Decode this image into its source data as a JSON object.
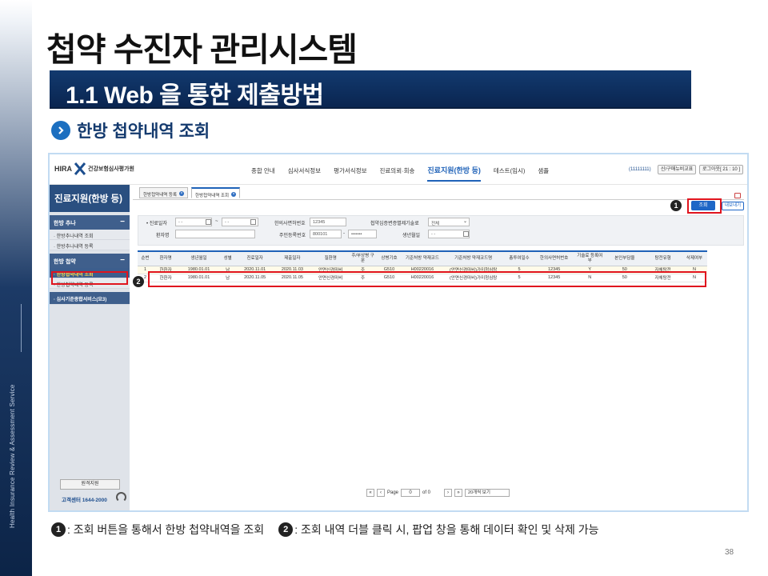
{
  "slide": {
    "title": "첩약 수진자 관리시스템",
    "section": "1.1 Web 을 통한 제출방법",
    "subtitle": "한방 첩약내역 조회",
    "side_vertical_text": "Health Insurance Review & Assessment Service",
    "page_number": "38",
    "note1_marker": "1",
    "note1_text": ": 조회 버튼을 통해서 한방 첩약내역을 조회",
    "note2_marker": "2",
    "note2_text": ": 조회 내역 더블 클릭 시, 팝업 창을 통해 데이터 확인 및 삭제 가능"
  },
  "app": {
    "logo_text": "HIRA",
    "org_name": "건강보험심사평가원",
    "nav": [
      "종합 안내",
      "심사서식정보",
      "평가서식정보",
      "진료의뢰·회송",
      "진료지원(한방 등)",
      "테스트(임시)",
      "샘플"
    ],
    "user_id": "(11111111)",
    "btn_change": "신/구매뉴비교표",
    "btn_logout": "로그아웃[ 21 : 10 ]",
    "sidebar": {
      "title": "진료지원(한방 등)",
      "group1": "한방 추나",
      "group1_items": [
        "· 한방추나내역 조회",
        "· 한방추나내역 등록"
      ],
      "group2": "한방 첩약",
      "group2_items": [
        "· 한방첩약내역 조회",
        "· 한방첩약내역 등록"
      ],
      "other": "· 심사기준종합서비스(요3)",
      "help_btn": "원격지원",
      "phone": "고객센터 1644-2000"
    },
    "tabs": [
      "한방첩약내역 등록",
      "한방첩약내역 조회"
    ],
    "search_btn": "조회",
    "export_btn": "내보내기",
    "filters": {
      "date_label": "• 진료일자",
      "date_from": "- -",
      "date_to": "- -",
      "date_sep": "~",
      "license_label": "한의사면허번호",
      "license_value": "12345",
      "exclude_label": "첩약심증변증별제기술료",
      "exclude_value": "전체",
      "patient_label": "환자명",
      "rrn_label": "주민등록번호",
      "rrn_front": "800101",
      "rrn_dash": "-",
      "rrn_back": "•••••••",
      "birth_label": "생년월일",
      "birth_value": "- -"
    },
    "columns": [
      "순번",
      "환자명",
      "생년월일",
      "성별",
      "진료일자",
      "제출일자",
      "질환명",
      "주/부상병 구분",
      "상병기호",
      "기준처방 약재코드",
      "기준처방 약재코드명",
      "총투여일수",
      "한의사면허번호",
      "기술료 등록여부",
      "본인부담율",
      "탕전유형",
      "삭제여부"
    ],
    "rows": [
      [
        "1",
        "한환자",
        "1980.01.01",
        "남",
        "2020.11.01",
        "2020.11.03",
        "안면신경마비",
        "주",
        "G510",
        "H00220016",
        "(안면신경마비)가미청심탕",
        "5",
        "12345",
        "Y",
        "50",
        "자체탕전",
        "N"
      ],
      [
        "2",
        "한환자",
        "1980.01.01",
        "남",
        "2020.11.05",
        "2020.11.05",
        "안면신경마비",
        "주",
        "G510",
        "H00220016",
        "(안면신경마비)가미청심탕",
        "5",
        "12345",
        "N",
        "50",
        "자체탕전",
        "N"
      ]
    ],
    "pager": {
      "page_label": "Page",
      "page_value": "0",
      "of_label": "of 0",
      "per_page": "20개씩 보기",
      "first": "«",
      "prev": "‹",
      "next": "›",
      "last": "»"
    },
    "marker1": "1",
    "marker2": "2"
  }
}
